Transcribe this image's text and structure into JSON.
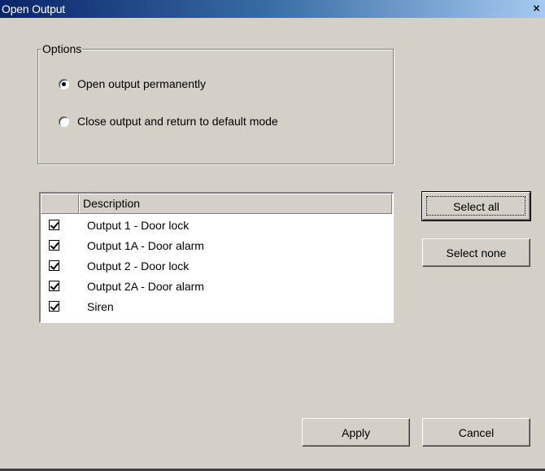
{
  "window": {
    "title": "Open Output",
    "close_glyph": "×"
  },
  "options": {
    "group_label": "Options",
    "radios": [
      {
        "label": "Open output permanently",
        "checked": true
      },
      {
        "label": "Close output and return to default mode",
        "checked": false
      }
    ]
  },
  "list": {
    "columns": [
      "",
      "Description"
    ],
    "rows": [
      {
        "label": "Output 1 - Door lock",
        "checked": true
      },
      {
        "label": "Output 1A - Door alarm",
        "checked": true
      },
      {
        "label": "Output 2 - Door lock",
        "checked": true
      },
      {
        "label": "Output 2A - Door alarm",
        "checked": true
      },
      {
        "label": "Siren",
        "checked": true
      }
    ]
  },
  "buttons": {
    "select_all": "Select all",
    "select_none": "Select none",
    "apply": "Apply",
    "cancel": "Cancel"
  }
}
